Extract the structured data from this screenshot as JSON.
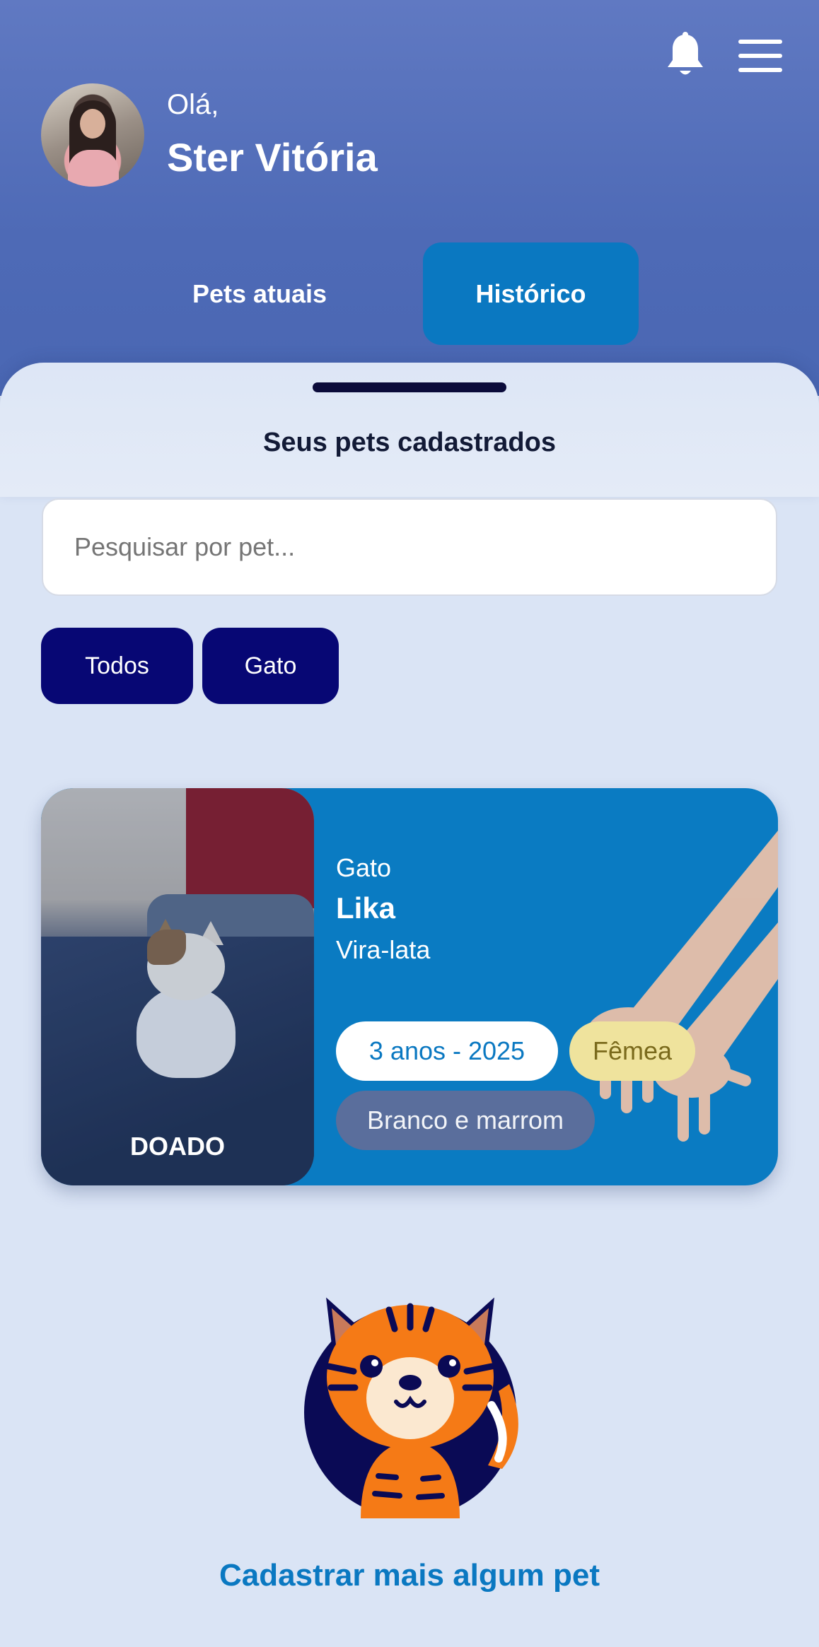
{
  "header": {
    "greeting": "Olá,",
    "user_name": "Ster Vitória",
    "tabs": [
      {
        "label": "Pets atuais",
        "active": false
      },
      {
        "label": "Histórico",
        "active": true
      }
    ],
    "icons": {
      "notifications": "bell-icon",
      "menu": "hamburger-menu-icon"
    }
  },
  "sheet": {
    "title": "Seus pets cadastrados"
  },
  "search": {
    "placeholder": "Pesquisar por pet..."
  },
  "filters": [
    {
      "label": "Todos"
    },
    {
      "label": "Gato"
    }
  ],
  "pet_card": {
    "status": "DOADO",
    "type": "Gato",
    "name": "Lika",
    "breed": "Vira-lata",
    "age": "3 anos - 2025",
    "sex": "Fêmea",
    "color": "Branco e marrom"
  },
  "footer": {
    "cta_label": "Cadastrar mais algum pet"
  },
  "colors": {
    "header_bg": "#5672bd",
    "accent": "#0a78c1",
    "chip_bg": "#070774",
    "page_bg": "#dae4f5",
    "sex_tag_bg": "#efe39d",
    "color_tag_bg": "#5a6e9c"
  }
}
